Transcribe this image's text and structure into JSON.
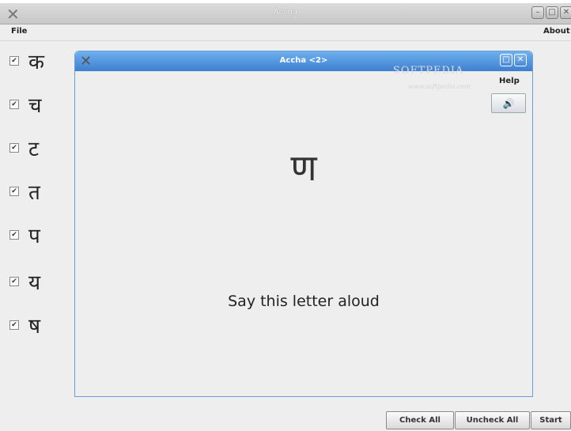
{
  "main_window": {
    "title": "Accha",
    "controls": [
      "minimize-icon",
      "maximize-icon",
      "close-icon"
    ]
  },
  "menu": {
    "file": "File",
    "about": "About"
  },
  "letters": [
    {
      "char": "क",
      "checked": true
    },
    {
      "char": "च",
      "checked": true
    },
    {
      "char": "ट",
      "checked": true
    },
    {
      "char": "त",
      "checked": true
    },
    {
      "char": "प",
      "checked": true
    },
    {
      "char": "य",
      "checked": true
    },
    {
      "char": "ष",
      "checked": true
    }
  ],
  "inner_window": {
    "title": "Accha <2>",
    "help": "Help",
    "speaker_icon": "speaker-icon",
    "current_letter": "ण",
    "prompt": "Say this letter aloud",
    "watermark": "SOFTPEDIA",
    "watermark_url": "www.softpedia.com"
  },
  "buttons": {
    "check_all": "Check All",
    "uncheck_all": "Uncheck All",
    "start": "Start"
  },
  "colors": {
    "inner_titlebar": "#4a88d4",
    "background": "#eeeeee"
  }
}
